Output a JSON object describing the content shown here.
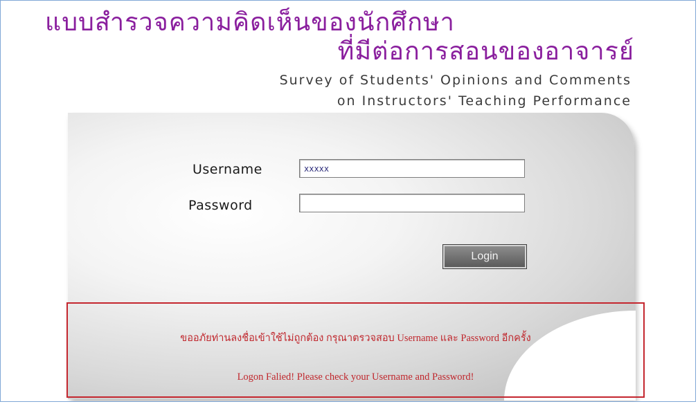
{
  "header": {
    "title_th_line1": "แบบสำรวจความคิดเห็นของนักศึกษา",
    "title_th_line2": "ที่มีต่อการสอนของอาจารย์",
    "title_en_line1": "Survey of Students' Opinions and Comments",
    "title_en_line2": "on Instructors' Teaching Performance"
  },
  "login_form": {
    "username_label": "Username",
    "username_value": "xxxxx",
    "password_label": "Password",
    "password_value": "",
    "login_button": "Login"
  },
  "error": {
    "message_th": "ขออภัยท่านลงชื่อเข้าใช้ไม่ถูกต้อง กรุณาตรวจสอบ Username และ Password อีกครั้ง",
    "message_en": "Logon Falied! Please check your Username and Password!"
  },
  "colors": {
    "title_purple": "#8a1f9e",
    "error_red": "#c0272d",
    "frame_blue": "#7fa7d6"
  }
}
